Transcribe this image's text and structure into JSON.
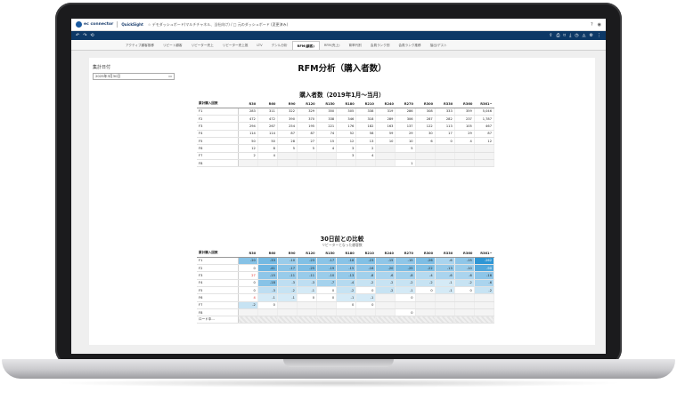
{
  "topbar": {
    "brand": "ec connector",
    "product": "QuickSight",
    "crumb": "☆ デモダッシュボード(マルチチャネル、当社向け) / □ 元のダッシュボード (変更済み)",
    "icons": [
      "help-icon",
      "user-icon"
    ]
  },
  "toolbar": {
    "left_icons": [
      "undo-icon",
      "redo-icon",
      "reset-icon"
    ],
    "right_icons": [
      "share-icon",
      "print-icon",
      "bookmark-icon",
      "download-icon",
      "schedule-icon",
      "alert-icon",
      "settings-icon",
      "menu-icon"
    ]
  },
  "tabs": [
    "アクティブ顧客推移",
    "リピート顧客",
    "リピーター売上",
    "リピーター売上推",
    "LTV",
    "デシル分析",
    "RFM(顧客)",
    "RFM(売上)",
    "育率代別",
    "会員ランク別",
    "会員ランク推移",
    "抽出/デスト"
  ],
  "active_tab": 6,
  "filter": {
    "label": "集計日付",
    "date": "2025年3月30日"
  },
  "main_title": "RFM分析（購入者数）",
  "table1": {
    "title": "購入者数（2019年1月〜当月）",
    "row_header": "累計購入回数",
    "columns": [
      "R30",
      "R60",
      "R90",
      "R120",
      "R150",
      "R180",
      "R210",
      "R240",
      "R270",
      "R300",
      "R330",
      "R360",
      "R361~"
    ],
    "rows": [
      {
        "label": "F1",
        "values": [
          "283",
          "311",
          "322",
          "329",
          "350",
          "305",
          "338",
          "319",
          "286",
          "308",
          "333",
          "359",
          "5,046"
        ]
      },
      {
        "label": "F2",
        "values": [
          "472",
          "472",
          "390",
          "370",
          "338",
          "346",
          "318",
          "289",
          "306",
          "287",
          "282",
          "237",
          "1,787"
        ]
      },
      {
        "label": "F3",
        "values": [
          "294",
          "267",
          "254",
          "195",
          "221",
          "176",
          "182",
          "163",
          "137",
          "122",
          "113",
          "105",
          "467"
        ]
      },
      {
        "label": "F4",
        "values": [
          "114",
          "114",
          "87",
          "87",
          "74",
          "52",
          "58",
          "59",
          "29",
          "30",
          "17",
          "29",
          "87"
        ]
      },
      {
        "label": "F5",
        "values": [
          "50",
          "50",
          "28",
          "27",
          "15",
          "12",
          "13",
          "10",
          "10",
          "6",
          "0",
          "4",
          "12"
        ]
      },
      {
        "label": "F6",
        "values": [
          "12",
          "8",
          "5",
          "5",
          "4",
          "3",
          "2",
          "",
          "5",
          "",
          "",
          "",
          ""
        ]
      },
      {
        "label": "F7",
        "values": [
          "2",
          "4",
          "",
          "",
          "",
          "3",
          "4",
          "",
          "",
          "",
          "",
          "",
          ""
        ]
      },
      {
        "label": "F8",
        "values": [
          "",
          "",
          "",
          "",
          "",
          "",
          "",
          "",
          "1",
          "",
          "",
          "",
          ""
        ]
      }
    ]
  },
  "table2": {
    "title": "30日前との比較",
    "subtitle": "リピーターとなった顧客数",
    "row_header": "累計購入回数",
    "columns": [
      "R30",
      "R60",
      "R90",
      "R120",
      "R150",
      "R180",
      "R210",
      "R240",
      "R270",
      "R300",
      "R330",
      "R360",
      "R361~"
    ],
    "rows": [
      {
        "label": "F1",
        "values": [
          "-20",
          "-33",
          "-10",
          "-23",
          "-17",
          "-18",
          "-23",
          "-15",
          "-15",
          "-26",
          "-6",
          "-15",
          "-262"
        ]
      },
      {
        "label": "F2",
        "values": [
          "0",
          "-41",
          "-17",
          "-25",
          "-19",
          "-15",
          "-16",
          "-20",
          "-25",
          "-22",
          "-13",
          "-10",
          "-90"
        ]
      },
      {
        "label": "F3",
        "values": [
          "27",
          "-15",
          "-11",
          "-11",
          "-10",
          "-13",
          "-8",
          "-6",
          "-8",
          "-4",
          "-6",
          "-6",
          "-16"
        ]
      },
      {
        "label": "F4",
        "values": [
          "0",
          "-18",
          "-3",
          "-3",
          "-7",
          "-4",
          "-2",
          "-2",
          "-2",
          "-2",
          "-1",
          "-2",
          "-6"
        ]
      },
      {
        "label": "F5",
        "values": [
          "0",
          "-3",
          "-2",
          "-1",
          "0",
          "-2",
          "0",
          "-2",
          "-1",
          "0",
          "-1",
          "0",
          "-2"
        ]
      },
      {
        "label": "F6",
        "values": [
          "4",
          "-1",
          "-1",
          "0",
          "0",
          "-1",
          "-1",
          "",
          "0",
          "",
          "",
          "",
          ""
        ]
      },
      {
        "label": "F7",
        "values": [
          "-2",
          "0",
          "",
          "",
          "",
          "0",
          "0",
          "",
          "",
          "",
          "",
          "",
          ""
        ]
      },
      {
        "label": "F8",
        "values": [
          "",
          "",
          "",
          "",
          "",
          "",
          "",
          "",
          "0",
          "",
          "",
          "",
          ""
        ]
      },
      {
        "label": "ロード中...",
        "values": [
          "",
          "",
          "",
          "",
          "",
          "",
          "",
          "",
          "",
          "",
          "",
          "",
          ""
        ]
      }
    ]
  },
  "colors": {
    "navy": "#0d3866",
    "heat_low": "#e6f4fb",
    "heat_high": "#1f8ed1",
    "positive": "#dd2222"
  }
}
